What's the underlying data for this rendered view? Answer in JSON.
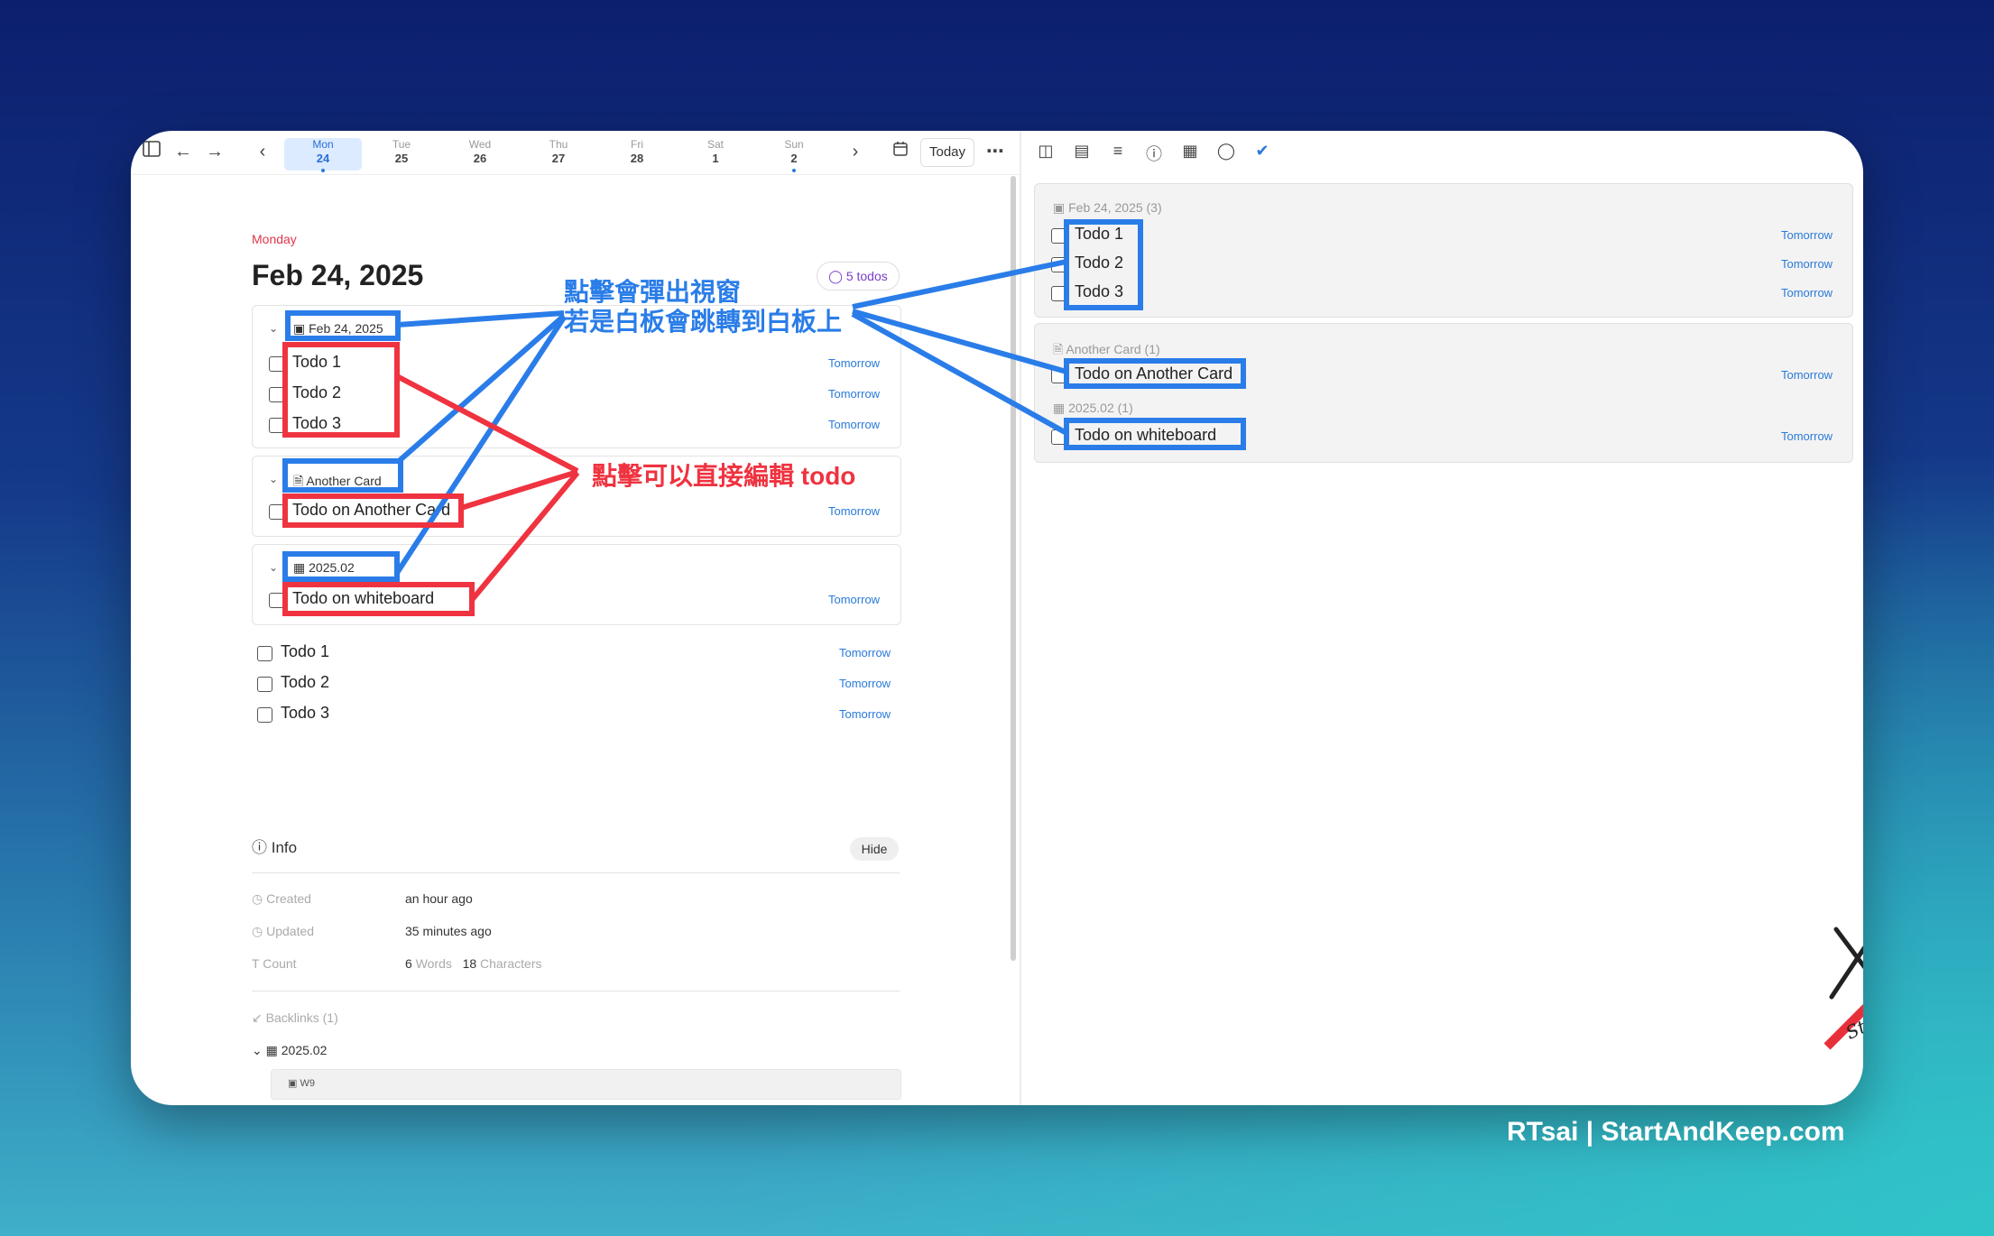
{
  "toolbar": {
    "days": [
      {
        "name": "Mon",
        "date": "24"
      },
      {
        "name": "Tue",
        "date": "25"
      },
      {
        "name": "Wed",
        "date": "26"
      },
      {
        "name": "Thu",
        "date": "27"
      },
      {
        "name": "Fri",
        "date": "28"
      },
      {
        "name": "Sat",
        "date": "1"
      },
      {
        "name": "Sun",
        "date": "2"
      }
    ],
    "today_label": "Today"
  },
  "page": {
    "weekday": "Monday",
    "title": "Feb 24, 2025",
    "todos_badge": "5 todos"
  },
  "cards": [
    {
      "header": "Feb 24, 2025",
      "todos": [
        "Todo 1",
        "Todo 2",
        "Todo 3"
      ]
    },
    {
      "header": "Another Card",
      "todos": [
        "Todo on Another Card"
      ]
    },
    {
      "header": "2025.02",
      "todos": [
        "Todo on whiteboard"
      ]
    }
  ],
  "inline_todos": [
    "Todo 1",
    "Todo 2",
    "Todo 3"
  ],
  "tomorrow_label": "Tomorrow",
  "info": {
    "title": "Info",
    "hide": "Hide",
    "created_label": "Created",
    "created_value": "an hour ago",
    "updated_label": "Updated",
    "updated_value": "35 minutes ago",
    "count_label": "Count",
    "words_num": "6",
    "words_label": "Words",
    "chars_num": "18",
    "chars_label": "Characters",
    "backlinks": "Backlinks (1)",
    "backlink_item": "2025.02",
    "backlink_sub": "W9"
  },
  "right_pane": {
    "groups": [
      {
        "header": "Feb 24, 2025 (3)",
        "todos": [
          "Todo 1",
          "Todo 2",
          "Todo 3"
        ]
      },
      {
        "header": "Another Card (1)",
        "todos": [
          "Todo on Another Card"
        ]
      },
      {
        "header": "2025.02 (1)",
        "todos": [
          "Todo on whiteboard"
        ]
      }
    ]
  },
  "annotations": {
    "blue_line1": "點擊會彈出視窗",
    "blue_line2": "若是白板會跳轉到白板上",
    "red": "點擊可以直接編輯 todo"
  },
  "footer": "RTsai | StartAndKeep.com",
  "colors": {
    "blue": "#2a7de8",
    "red": "#ef3340",
    "accent": "#2a7ad8",
    "weekday": "#e0364b"
  }
}
